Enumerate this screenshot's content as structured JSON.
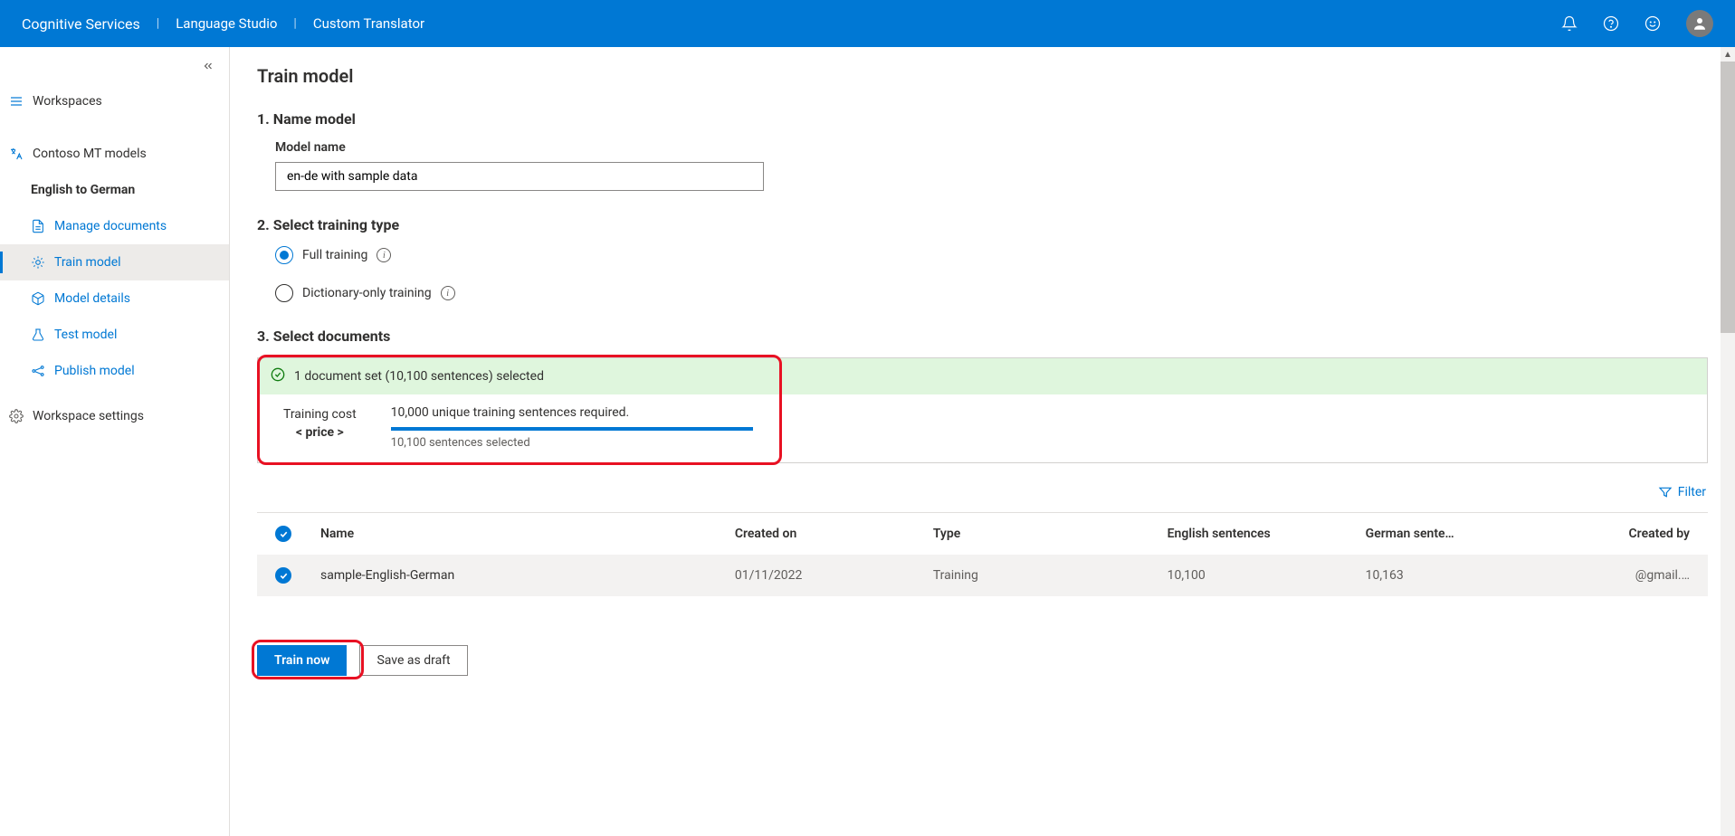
{
  "header": {
    "brand": "Cognitive Services",
    "links": [
      "Language Studio",
      "Custom Translator"
    ]
  },
  "sidebar": {
    "workspaces_label": "Workspaces",
    "workspace_name": "Contoso MT models",
    "project_name": "English to German",
    "items": [
      {
        "label": "Manage documents"
      },
      {
        "label": "Train model"
      },
      {
        "label": "Model details"
      },
      {
        "label": "Test model"
      },
      {
        "label": "Publish model"
      }
    ],
    "settings_label": "Workspace settings"
  },
  "main": {
    "title": "Train model",
    "step1": {
      "heading": "1. Name model",
      "field_label": "Model name",
      "value": "en-de with sample data"
    },
    "step2": {
      "heading": "2. Select training type",
      "options": [
        {
          "label": "Full training",
          "checked": true
        },
        {
          "label": "Dictionary-only training",
          "checked": false
        }
      ]
    },
    "step3": {
      "heading": "3. Select documents",
      "banner": {
        "status": "1 document set (10,100 sentences) selected",
        "cost_label": "Training cost",
        "cost_price": "< price >",
        "requirement": "10,000 unique training sentences required.",
        "selected": "10,100 sentences selected"
      },
      "filter_label": "Filter",
      "columns": {
        "name": "Name",
        "created": "Created on",
        "type": "Type",
        "eng": "English sentences",
        "ger": "German sente…",
        "by": "Created by"
      },
      "rows": [
        {
          "name": "sample-English-German",
          "created": "01/11/2022",
          "type": "Training",
          "eng": "10,100",
          "ger": "10,163",
          "by": "@gmail.…"
        }
      ]
    },
    "actions": {
      "train": "Train now",
      "save": "Save as draft"
    }
  }
}
